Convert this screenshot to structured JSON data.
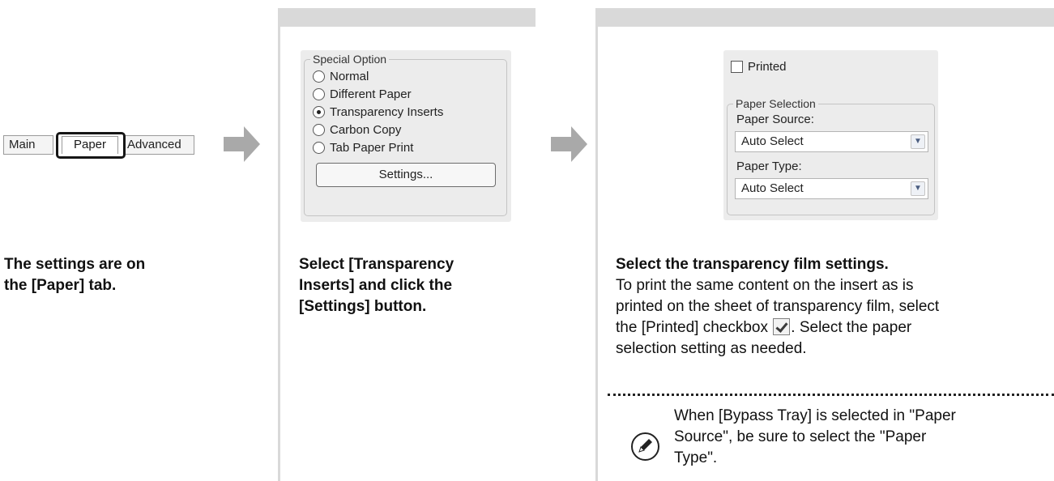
{
  "step1": {
    "tabs": [
      "Main",
      "Paper",
      "Advanced"
    ],
    "caption_lines": [
      "The settings are on",
      "the [Paper] tab."
    ]
  },
  "step2": {
    "group_title": "Special Option",
    "options": [
      {
        "label": "Normal",
        "checked": false
      },
      {
        "label": "Different Paper",
        "checked": false
      },
      {
        "label": "Transparency Inserts",
        "checked": true
      },
      {
        "label": "Carbon Copy",
        "checked": false
      },
      {
        "label": "Tab Paper Print",
        "checked": false
      }
    ],
    "button_label": "Settings...",
    "caption_lines": [
      "Select [Transparency",
      "Inserts] and click the",
      "[Settings] button."
    ]
  },
  "step3": {
    "printed_label": "Printed",
    "printed_checked": false,
    "group_title": "Paper Selection",
    "paper_source_label": "Paper Source:",
    "paper_source_value": "Auto Select",
    "paper_type_label": "Paper Type:",
    "paper_type_value": "Auto Select",
    "heading": "Select the transparency film settings.",
    "body_line1": "To print the same content on the insert as is",
    "body_line2": "printed on the sheet of transparency film, select",
    "body_line3_before": "the [Printed] checkbox",
    "body_line3_after": ". Select the paper",
    "body_line4": "selection setting as needed."
  },
  "note": {
    "lines": [
      "When [Bypass Tray] is selected in \"Paper",
      "Source\", be sure to select the \"Paper",
      "Type\"."
    ]
  },
  "colors": {
    "panel_bar": "#d9d9d9",
    "arrow": "#a9a9a9",
    "dialog_bg": "#ececec"
  },
  "icons": {
    "arrow_1": "right-arrow-icon",
    "arrow_2": "right-arrow-icon",
    "note": "pencil-icon",
    "dropdown": "chevron-down-icon",
    "inline_checkbox": "checkmark-checkbox-icon"
  }
}
